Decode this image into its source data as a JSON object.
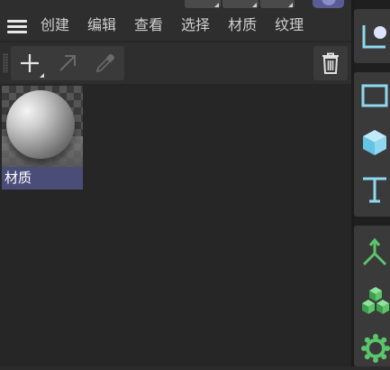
{
  "menubar": {
    "items": [
      "创建",
      "编辑",
      "查看",
      "选择",
      "材质",
      "纹理"
    ]
  },
  "materials": [
    {
      "name": "材质"
    }
  ],
  "icons": {
    "menu": "hamburger-menu-icon",
    "new": "plus-icon",
    "apply": "arrow-up-right-icon",
    "picker": "eyedropper-icon",
    "delete": "trash-icon"
  },
  "sidebar_icons": [
    "camera-icon",
    "rectangle-icon",
    "cube-icon",
    "text-tool-icon",
    "axis-icon",
    "cubes-icon",
    "gear-icon"
  ],
  "colors": {
    "panel": "#2e2e2e",
    "content": "#262626",
    "selection": "#4b4d79",
    "accent_blue": "#8fd8f0",
    "accent_green": "#5cc46b"
  }
}
